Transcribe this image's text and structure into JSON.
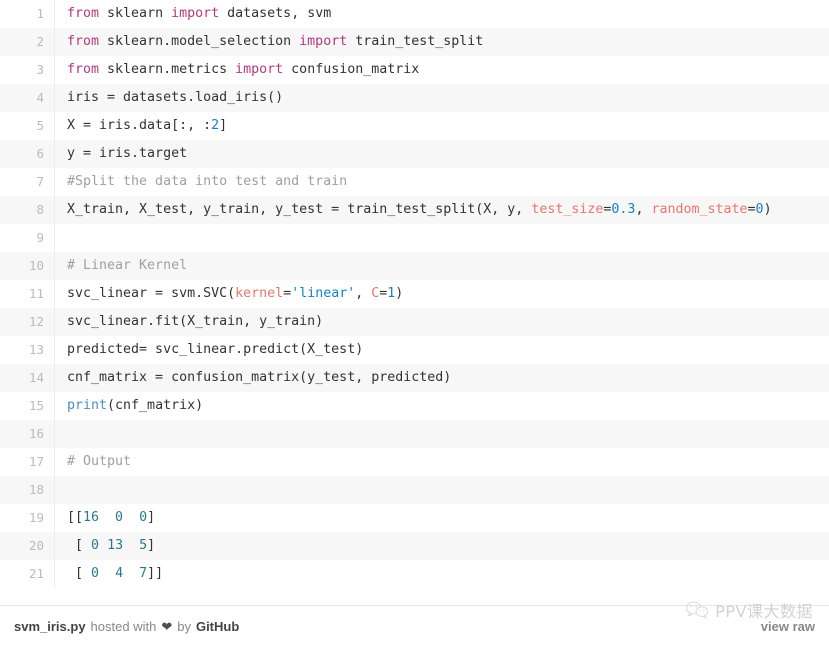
{
  "gist": {
    "filename": "svm_iris.py",
    "lines": [
      {
        "num": "1",
        "tokens": [
          {
            "t": "from",
            "c": "k"
          },
          {
            "t": " sklearn ",
            "c": "p"
          },
          {
            "t": "import",
            "c": "k"
          },
          {
            "t": " datasets, svm",
            "c": "p"
          }
        ]
      },
      {
        "num": "2",
        "tokens": [
          {
            "t": "from",
            "c": "k"
          },
          {
            "t": " sklearn.model_selection ",
            "c": "p"
          },
          {
            "t": "import",
            "c": "k"
          },
          {
            "t": " train_test_split",
            "c": "p"
          }
        ]
      },
      {
        "num": "3",
        "tokens": [
          {
            "t": "from",
            "c": "k"
          },
          {
            "t": " sklearn.metrics ",
            "c": "p"
          },
          {
            "t": "import",
            "c": "k"
          },
          {
            "t": " confusion_matrix",
            "c": "p"
          }
        ]
      },
      {
        "num": "4",
        "tokens": [
          {
            "t": "iris = datasets.load_iris()",
            "c": "p"
          }
        ]
      },
      {
        "num": "5",
        "tokens": [
          {
            "t": "X = iris.data[:, :",
            "c": "p"
          },
          {
            "t": "2",
            "c": "n"
          },
          {
            "t": "]",
            "c": "p"
          }
        ]
      },
      {
        "num": "6",
        "tokens": [
          {
            "t": "y = iris.target",
            "c": "p"
          }
        ]
      },
      {
        "num": "7",
        "tokens": [
          {
            "t": "#Split the data into test and train",
            "c": "c"
          }
        ]
      },
      {
        "num": "8",
        "tokens": [
          {
            "t": "X_train, X_test, y_train, y_test = train_test_split(X, y, ",
            "c": "p"
          },
          {
            "t": "test_size",
            "c": "a"
          },
          {
            "t": "=",
            "c": "p"
          },
          {
            "t": "0.3",
            "c": "n"
          },
          {
            "t": ", ",
            "c": "p"
          },
          {
            "t": "random_state",
            "c": "a"
          },
          {
            "t": "=",
            "c": "p"
          },
          {
            "t": "0",
            "c": "n"
          },
          {
            "t": ")",
            "c": "p"
          }
        ]
      },
      {
        "num": "9",
        "tokens": [
          {
            "t": "",
            "c": "p"
          }
        ]
      },
      {
        "num": "10",
        "tokens": [
          {
            "t": "# Linear Kernel",
            "c": "c"
          }
        ]
      },
      {
        "num": "11",
        "tokens": [
          {
            "t": "svc_linear = svm.SVC(",
            "c": "p"
          },
          {
            "t": "kernel",
            "c": "a"
          },
          {
            "t": "=",
            "c": "p"
          },
          {
            "t": "'linear'",
            "c": "s"
          },
          {
            "t": ", ",
            "c": "p"
          },
          {
            "t": "C",
            "c": "a"
          },
          {
            "t": "=",
            "c": "p"
          },
          {
            "t": "1",
            "c": "n"
          },
          {
            "t": ")",
            "c": "p"
          }
        ]
      },
      {
        "num": "12",
        "tokens": [
          {
            "t": "svc_linear.fit(X_train, y_train)",
            "c": "p"
          }
        ]
      },
      {
        "num": "13",
        "tokens": [
          {
            "t": "predicted= svc_linear.predict(X_test)",
            "c": "p"
          }
        ]
      },
      {
        "num": "14",
        "tokens": [
          {
            "t": "cnf_matrix = confusion_matrix(y_test, predicted)",
            "c": "p"
          }
        ]
      },
      {
        "num": "15",
        "tokens": [
          {
            "t": "print",
            "c": "b"
          },
          {
            "t": "(cnf_matrix)",
            "c": "p"
          }
        ]
      },
      {
        "num": "16",
        "tokens": [
          {
            "t": "",
            "c": "p"
          }
        ]
      },
      {
        "num": "17",
        "tokens": [
          {
            "t": "# Output",
            "c": "c"
          }
        ]
      },
      {
        "num": "18",
        "tokens": [
          {
            "t": "",
            "c": "p"
          }
        ]
      },
      {
        "num": "19",
        "tokens": [
          {
            "t": "[[",
            "c": "p"
          },
          {
            "t": "16",
            "c": "o"
          },
          {
            "t": "  ",
            "c": "p"
          },
          {
            "t": "0",
            "c": "o"
          },
          {
            "t": "  ",
            "c": "p"
          },
          {
            "t": "0",
            "c": "o"
          },
          {
            "t": "]",
            "c": "p"
          }
        ]
      },
      {
        "num": "20",
        "tokens": [
          {
            "t": " [ ",
            "c": "p"
          },
          {
            "t": "0",
            "c": "o"
          },
          {
            "t": " ",
            "c": "p"
          },
          {
            "t": "13",
            "c": "o"
          },
          {
            "t": "  ",
            "c": "p"
          },
          {
            "t": "5",
            "c": "o"
          },
          {
            "t": "]",
            "c": "p"
          }
        ]
      },
      {
        "num": "21",
        "tokens": [
          {
            "t": " [ ",
            "c": "p"
          },
          {
            "t": "0",
            "c": "o"
          },
          {
            "t": "  ",
            "c": "p"
          },
          {
            "t": "4",
            "c": "o"
          },
          {
            "t": "  ",
            "c": "p"
          },
          {
            "t": "7",
            "c": "o"
          },
          {
            "t": "]]",
            "c": "p"
          }
        ]
      }
    ],
    "meta": {
      "filename": "svm_iris.py",
      "hosted_with": "hosted with",
      "heart": "❤",
      "by": "by",
      "host": "GitHub",
      "view_raw": "view raw"
    }
  },
  "watermark": {
    "text": "PPV课大数据",
    "logo": "wechat-logo-icon"
  },
  "colors": {
    "keyword": "#b5397f",
    "comment": "#a0a0a0",
    "number": "#1183c4",
    "string": "#1183c4",
    "kwarg": "#e8776e",
    "builtin": "#4a90c4",
    "output_number": "#2b7a8c",
    "plain": "#333333",
    "stripe": "#f7f7f7",
    "gutter": "#bbbbbb"
  }
}
